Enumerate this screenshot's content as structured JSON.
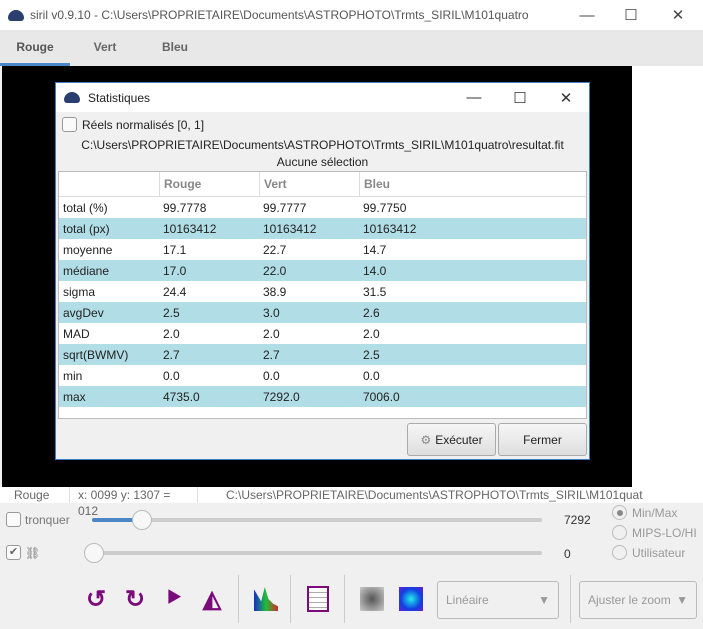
{
  "window": {
    "title": "siril v0.9.10 - C:\\Users\\PROPRIETAIRE\\Documents\\ASTROPHOTO\\Trmts_SIRIL\\M101quatro",
    "minimize": "—",
    "maximize": "☐",
    "close": "✕"
  },
  "tabs": [
    {
      "label": "Rouge"
    },
    {
      "label": "Vert"
    },
    {
      "label": "Bleu"
    }
  ],
  "dialog": {
    "title": "Statistiques",
    "normalized_label": "Réels normalisés [0, 1]",
    "path": "C:\\Users\\PROPRIETAIRE\\Documents\\ASTROPHOTO\\Trmts_SIRIL\\M101quatro\\resultat.fit",
    "selection": "Aucune sélection",
    "columns": [
      "",
      "Rouge",
      "Vert",
      "Bleu"
    ],
    "rows": [
      [
        "total (%)",
        "99.7778",
        "99.7777",
        "99.7750"
      ],
      [
        "total (px)",
        "10163412",
        "10163412",
        "10163412"
      ],
      [
        "moyenne",
        "17.1",
        "22.7",
        "14.7"
      ],
      [
        "médiane",
        "17.0",
        "22.0",
        "14.0"
      ],
      [
        "sigma",
        "24.4",
        "38.9",
        "31.5"
      ],
      [
        "avgDev",
        "2.5",
        "3.0",
        "2.6"
      ],
      [
        "MAD",
        "2.0",
        "2.0",
        "2.0"
      ],
      [
        "sqrt(BWMV)",
        "2.7",
        "2.7",
        "2.5"
      ],
      [
        "min",
        "0.0",
        "0.0",
        "0.0"
      ],
      [
        "max",
        "4735.0",
        "7292.0",
        "7006.0"
      ]
    ],
    "execute": "Exécuter",
    "close": "Fermer",
    "minimize": "—",
    "maximize": "☐",
    "close_icon": "✕"
  },
  "status": {
    "channel": "Rouge",
    "coords": "x: 0099 y: 1307 = 012",
    "path": "C:\\Users\\PROPRIETAIRE\\Documents\\ASTROPHOTO\\Trmts_SIRIL\\M101quat"
  },
  "controls": {
    "clip_label": "tronquer",
    "max_value": "7292",
    "min_value": "0",
    "max_slider_fraction": 0.11,
    "min_slider_fraction": 0.0,
    "radios": [
      "Min/Max",
      "MIPS-LO/HI",
      "Utilisateur"
    ],
    "selected_radio": "Min/Max",
    "scale": "Linéaire",
    "zoom": "Ajuster le zoom"
  }
}
